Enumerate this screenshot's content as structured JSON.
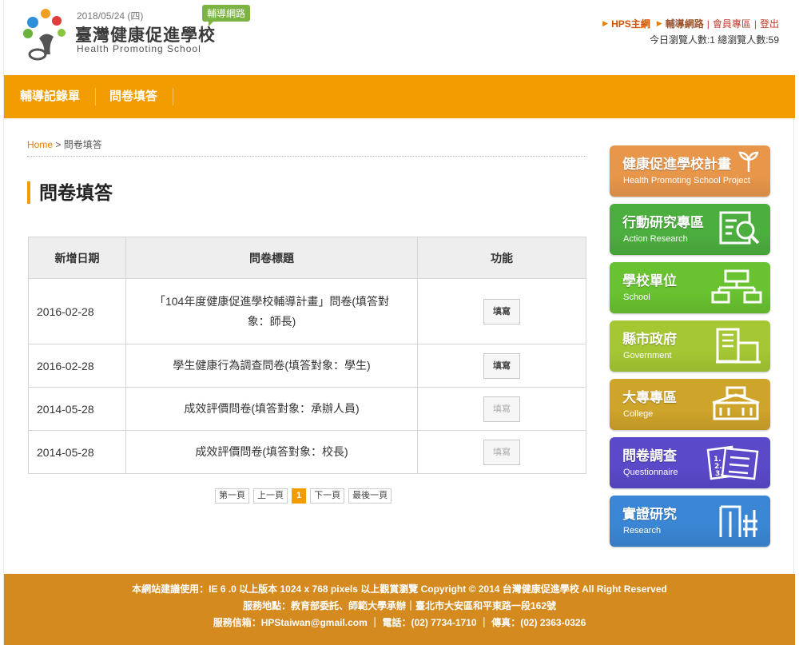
{
  "header": {
    "date": "2018/05/24 (四)",
    "badge": "輔導網路",
    "title": "臺灣健康促進學校",
    "subtitle": "Health Promoting School",
    "links": {
      "hps": "HPS主網",
      "support": "輔導網路",
      "member": "會員專區",
      "logout": "登出"
    },
    "visits": "今日瀏覽人數:1 總瀏覽人數:59"
  },
  "mainnav": [
    "輔導記錄單",
    "問卷填答"
  ],
  "breadcrumb": {
    "home": "Home",
    "separator": " > ",
    "current": "問卷填答"
  },
  "page_title": "問卷填答",
  "table": {
    "headers": [
      "新增日期",
      "問卷標題",
      "功能"
    ],
    "rows": [
      {
        "date": "2016-02-28",
        "title": "「104年度健康促進學校輔導計畫」問卷(填答對象：師長)",
        "action": "填寫",
        "enabled": true
      },
      {
        "date": "2016-02-28",
        "title": "學生健康行為調查問卷(填答對象：學生)",
        "action": "填寫",
        "enabled": true
      },
      {
        "date": "2014-05-28",
        "title": "成效評價問卷(填答對象：承辦人員)",
        "action": "填寫",
        "enabled": false
      },
      {
        "date": "2014-05-28",
        "title": "成效評價問卷(填答對象：校長)",
        "action": "填寫",
        "enabled": false
      }
    ]
  },
  "pager": {
    "first": "第一頁",
    "prev": "上一頁",
    "current": "1",
    "next": "下一頁",
    "last": "最後一頁"
  },
  "sidebar": [
    {
      "zh": "健康促進學校計畫",
      "en": "Health Promoting School Project",
      "color": "#e8964a",
      "icon": "sprout-icon"
    },
    {
      "zh": "行動研究專區",
      "en": "Action Research",
      "color": "#4cae3f",
      "icon": "magnifier-icon"
    },
    {
      "zh": "學校單位",
      "en": "School",
      "color": "#69c22f",
      "icon": "org-chart-icon"
    },
    {
      "zh": "縣市政府",
      "en": "Government",
      "color": "#a5c733",
      "icon": "building-icon"
    },
    {
      "zh": "大專專區",
      "en": "College",
      "color": "#cfa42a",
      "icon": "college-icon"
    },
    {
      "zh": "問卷調查",
      "en": "Questionnaire",
      "color": "#5a49c9",
      "icon": "document-list-icon"
    },
    {
      "zh": "實證研究",
      "en": "Research",
      "color": "#3a86d4",
      "icon": "columns-icon"
    }
  ],
  "footer": {
    "line1": "本網站建議使用：IE 6 .0 以上版本 1024 x 768 pixels 以上觀賞瀏覽 Copyright © 2014 台灣健康促進學校 All Right Reserved",
    "line2": "服務地點：教育部委託、師範大學承辦｜臺北市大安區和平東路一段162號",
    "line3": "服務信箱：HPStaiwan@gmail.com ｜ 電話：(02) 7734-1710 ｜ 傳真：(02) 2363-0326"
  }
}
